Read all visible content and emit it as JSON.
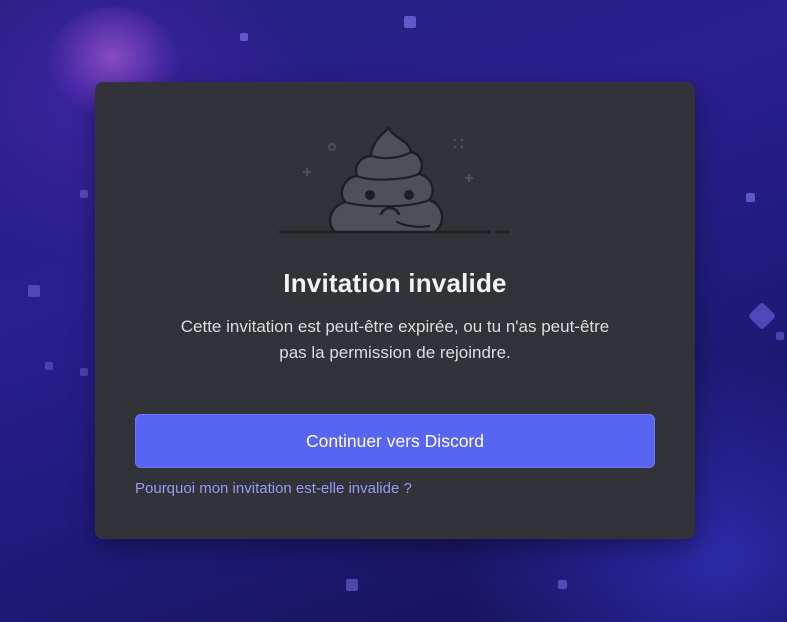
{
  "modal": {
    "title": "Invitation invalide",
    "description_line1": "Cette invitation est peut-être expirée, ou tu n'as peut-être",
    "description_line2": "pas la permission de rejoindre.",
    "continue_button_label": "Continuer vers Discord",
    "help_link_text": "Pourquoi mon invitation est-elle invalide ?",
    "illustration_icon": "sad-poop-icon"
  },
  "colors": {
    "modal_background": "#313338",
    "button_background": "#5865f2",
    "link_color": "#949cf7",
    "title_color": "#f2f3f5",
    "text_color": "#dbdee1"
  }
}
